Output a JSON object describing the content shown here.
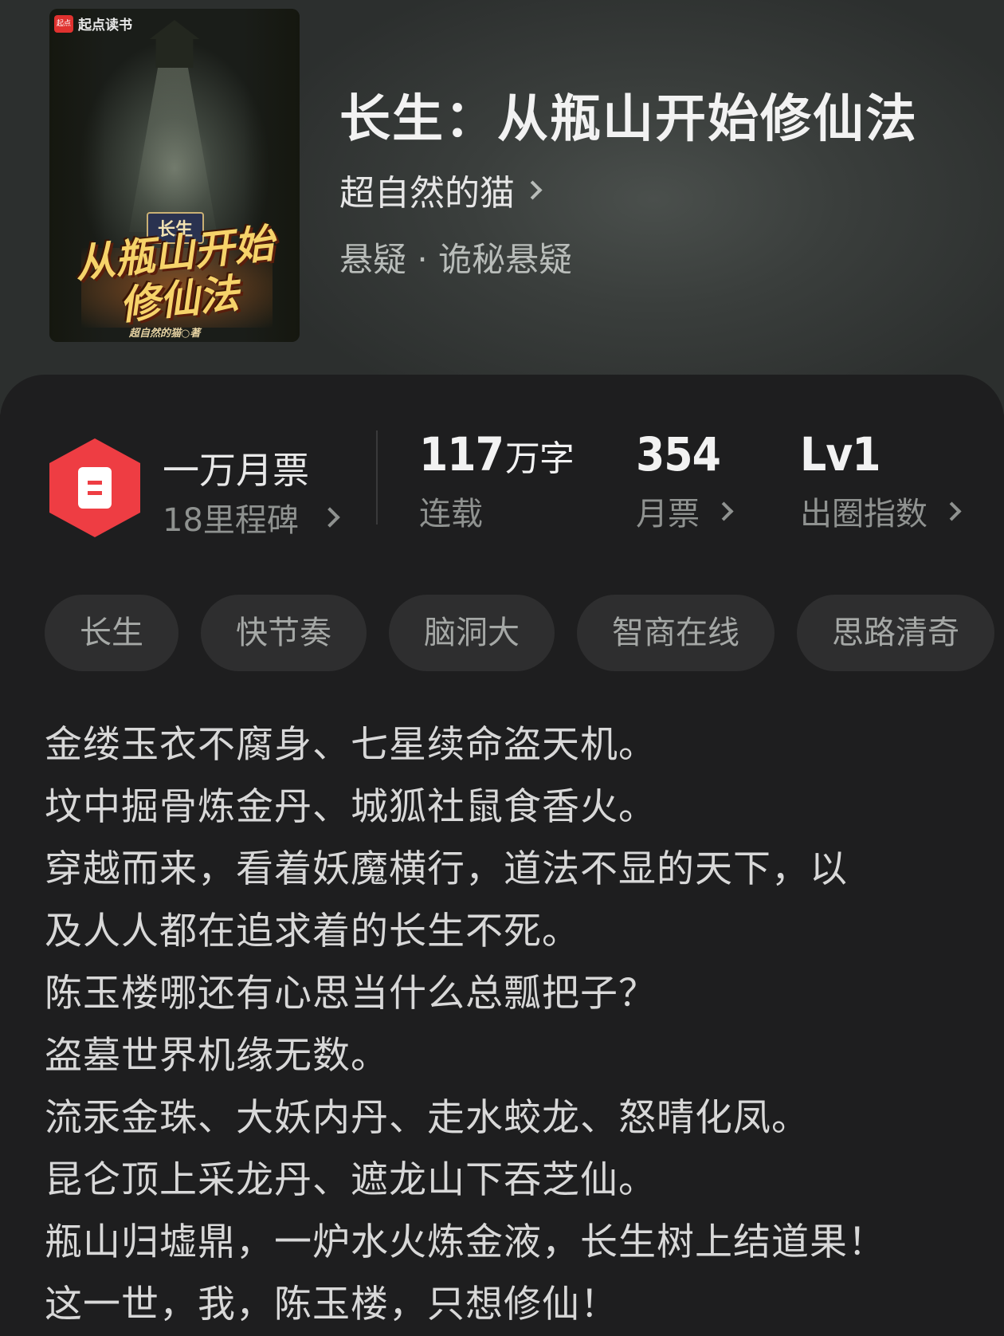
{
  "cover": {
    "brand": "起点读书",
    "brand_logo": "起点",
    "badge": "长生",
    "title_line1": "从瓶山开始",
    "title_line2": "修仙法",
    "author": "超自然的猫○著"
  },
  "book": {
    "title": "长生：从瓶山开始修仙法",
    "author": "超自然的猫",
    "genre": "悬疑 · 诡秘悬疑"
  },
  "stats": {
    "ticket_label": "一万月票",
    "ticket_sub": "18里程碑",
    "words_value": "117",
    "words_unit": "万字",
    "words_label": "连载",
    "votes_value": "354",
    "votes_label": "月票",
    "level_value": "Lv1",
    "level_label": "出圈指数"
  },
  "tags": [
    "长生",
    "快节奏",
    "脑洞大",
    "智商在线",
    "思路清奇"
  ],
  "synopsis": [
    "金缕玉衣不腐身、七星续命盗天机。",
    "坟中掘骨炼金丹、城狐社鼠食香火。",
    "穿越而来，看着妖魔横行，道法不显的天下，以",
    "及人人都在追求着的长生不死。",
    "陈玉楼哪还有心思当什么总瓢把子？",
    "盗墓世界机缘无数。",
    "流汞金珠、大妖内丹、走水蛟龙、怒晴化凤。",
    "昆仑顶上采龙丹、遮龙山下吞芝仙。",
    "瓶山归墟鼎，一炉水火炼金液，长生树上结道果！",
    "这一世，我，陈玉楼，只想修仙！"
  ],
  "colors": {
    "accent_red": "#ee3d43",
    "background": "#1e1e1f",
    "tag_bg": "#2e2e2f"
  },
  "icons": {
    "ticket": "monthly-ticket-icon",
    "chevron": "chevron-right-icon"
  }
}
